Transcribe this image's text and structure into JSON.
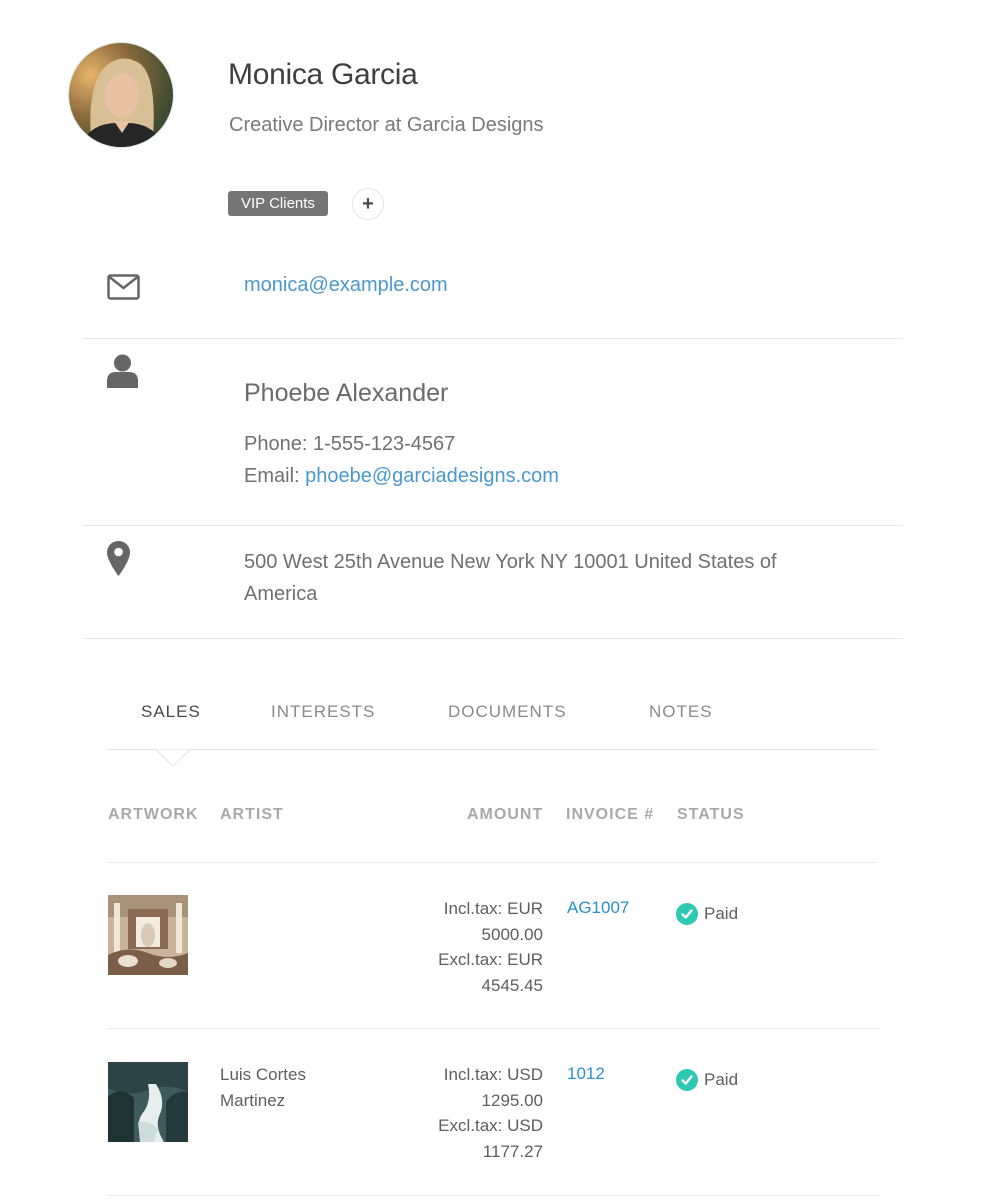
{
  "profile": {
    "name": "Monica Garcia",
    "job_title": "Creative Director at Garcia Designs",
    "tags": [
      "VIP Clients"
    ],
    "add_tag_symbol": "+"
  },
  "contact": {
    "email": "monica@example.com",
    "person": {
      "name": "Phoebe Alexander",
      "phone_label": "Phone:",
      "phone": "1-555-123-4567",
      "email_label": "Email:",
      "email": "phoebe@garciadesigns.com"
    },
    "address": "500 West 25th Avenue New York NY 10001 United States of America"
  },
  "icons": {
    "email": "envelope-icon",
    "person": "person-icon",
    "location": "map-pin-icon",
    "paid": "check-circle-icon"
  },
  "tabs": [
    {
      "label": "SALES",
      "active": true
    },
    {
      "label": "INTERESTS",
      "active": false
    },
    {
      "label": "DOCUMENTS",
      "active": false
    },
    {
      "label": "NOTES",
      "active": false
    }
  ],
  "sales_table": {
    "columns": [
      "ARTWORK",
      "ARTIST",
      "AMOUNT",
      "INVOICE #",
      "STATUS"
    ],
    "rows": [
      {
        "artist_line1": "",
        "artist_line2": "",
        "incl_line1": "Incl.tax: EUR",
        "incl_line2": "5000.00",
        "excl_line1": "Excl.tax: EUR",
        "excl_line2": "4545.45",
        "invoice": "AG1007",
        "status": "Paid"
      },
      {
        "artist_line1": "Luis Cortes",
        "artist_line2": "Martinez",
        "incl_line1": "Incl.tax: USD",
        "incl_line2": "1295.00",
        "excl_line1": "Excl.tax: USD",
        "excl_line2": "1177.27",
        "invoice": "1012",
        "status": "Paid"
      }
    ]
  },
  "colors": {
    "link": "#4a98cc",
    "tag_bg": "#757575",
    "paid_check": "#2ec9b2"
  }
}
